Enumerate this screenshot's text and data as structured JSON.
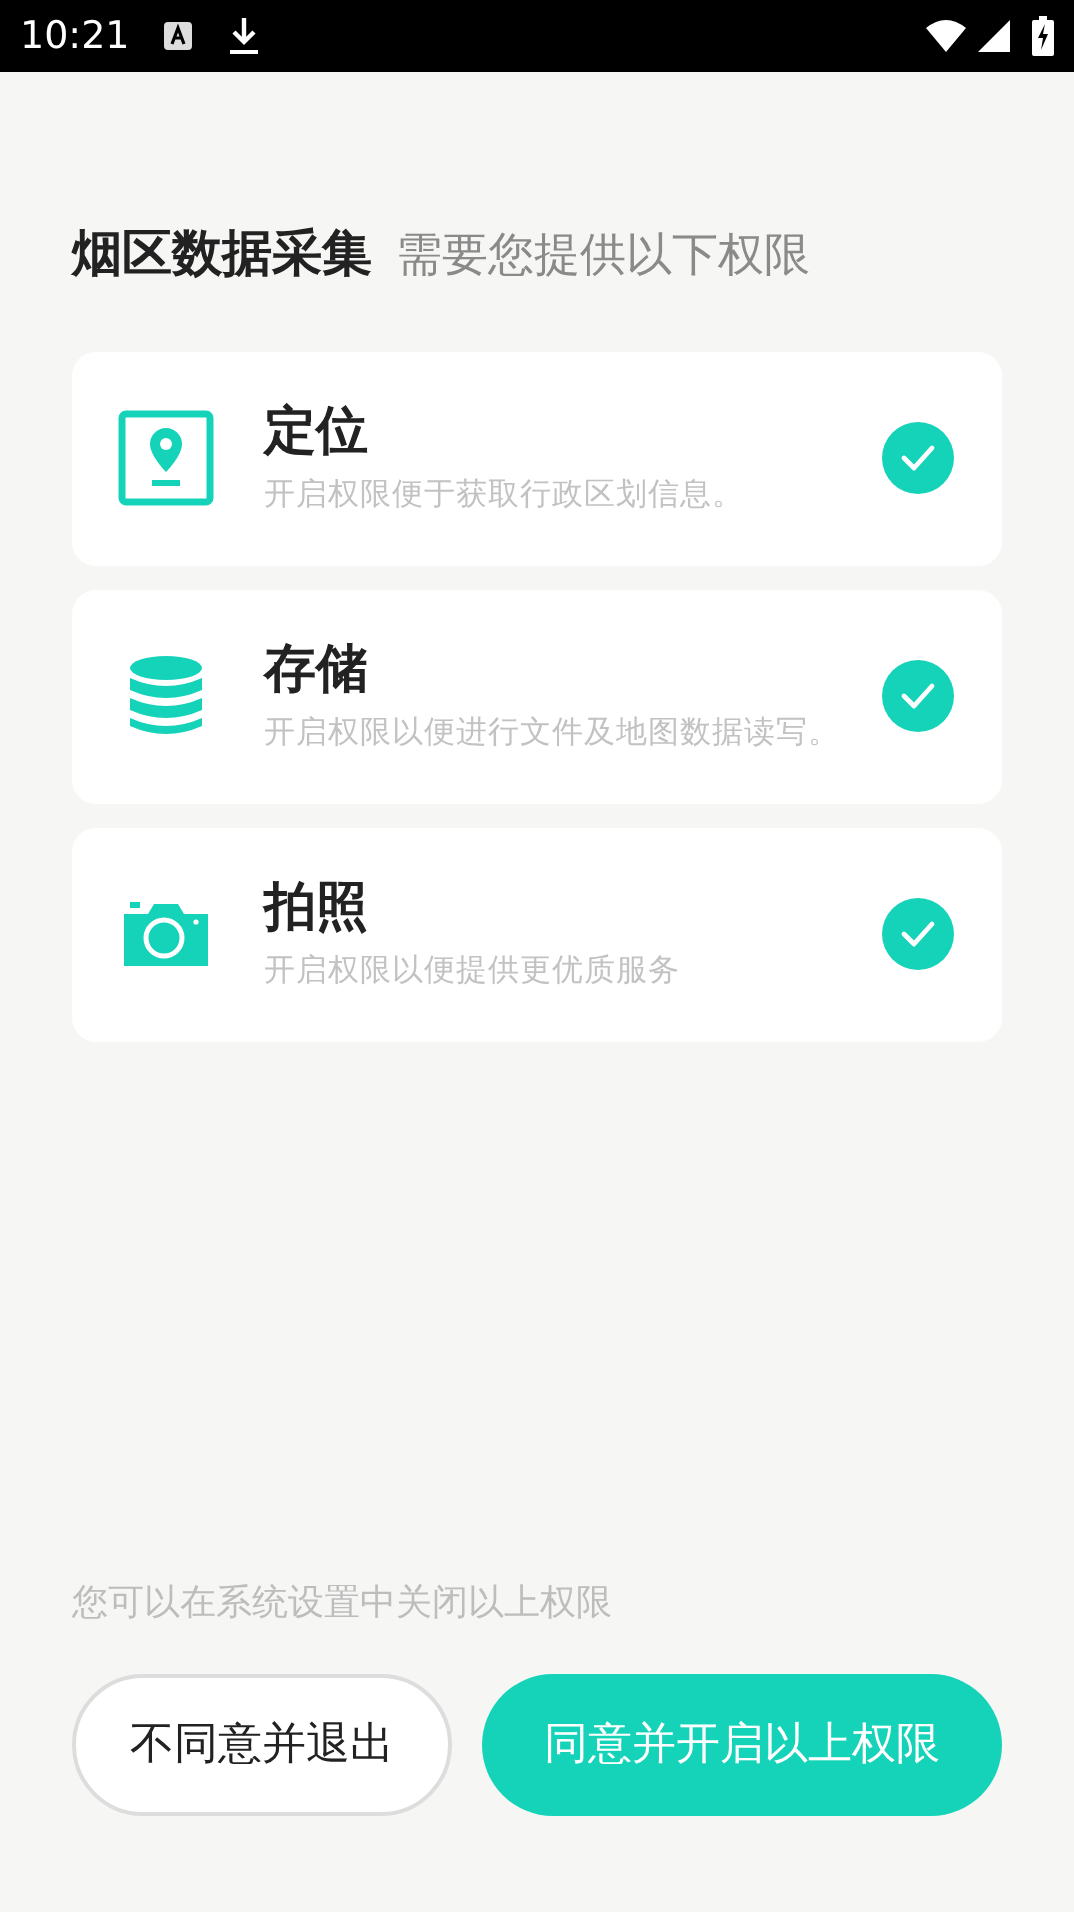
{
  "status_bar": {
    "time": "10:21"
  },
  "header": {
    "title": "烟区数据采集",
    "subtitle": "需要您提供以下权限"
  },
  "permissions": [
    {
      "kind": "location",
      "title": "定位",
      "description": "开启权限便于获取行政区划信息。",
      "granted": true
    },
    {
      "kind": "storage",
      "title": "存储",
      "description": "开启权限以便进行文件及地图数据读写。",
      "granted": true
    },
    {
      "kind": "camera",
      "title": "拍照",
      "description": "开启权限以便提供更优质服务",
      "granted": true
    }
  ],
  "footer": {
    "note": "您可以在系统设置中关闭以上权限",
    "buttons": [
      {
        "kind": "decline",
        "label": "不同意并退出"
      },
      {
        "kind": "accept",
        "label": "同意并开启以上权限"
      }
    ]
  }
}
